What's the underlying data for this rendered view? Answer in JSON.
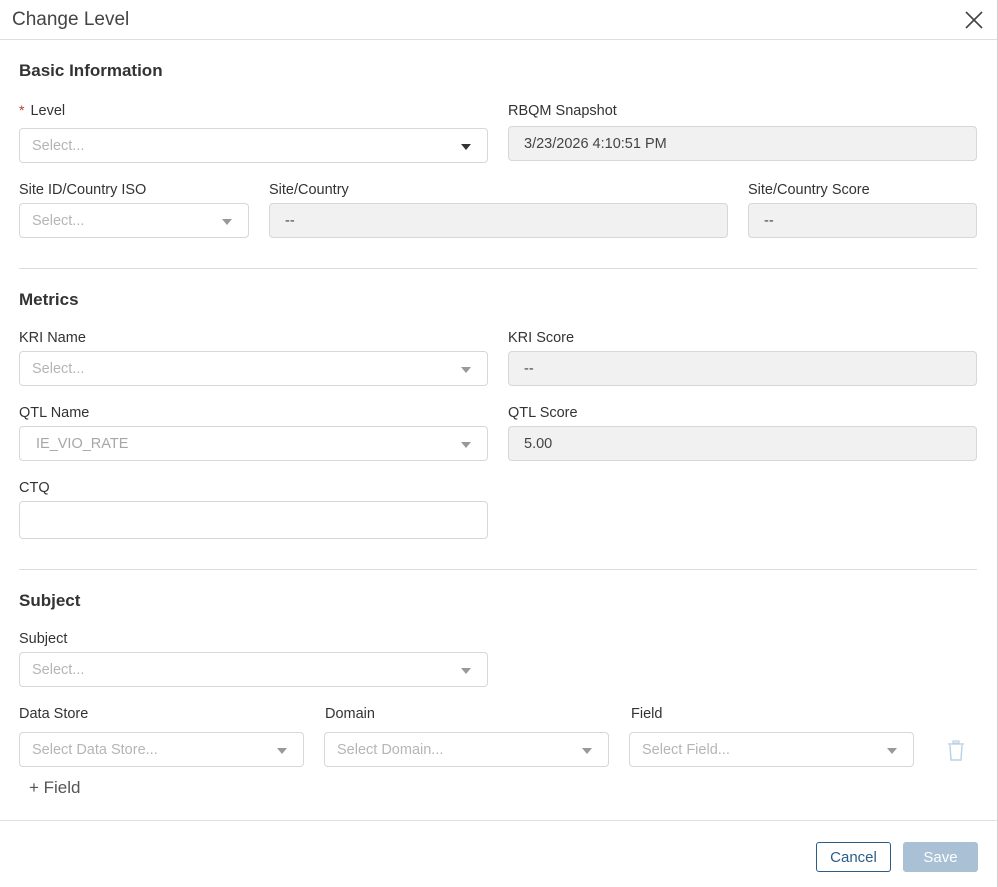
{
  "dialog": {
    "title": "Change Level",
    "close_icon": "close-icon"
  },
  "basic": {
    "section_title": "Basic Information",
    "level_label": "Level",
    "level_required_mark": "*",
    "level_placeholder": "Select...",
    "snapshot_label": "RBQM Snapshot",
    "snapshot_value": "3/23/2026 4:10:51 PM",
    "site_id_label": "Site ID/Country ISO",
    "site_id_placeholder": "Select...",
    "site_country_label": "Site/Country",
    "site_country_value": "--",
    "site_score_label": "Site/Country Score",
    "site_score_value": "--"
  },
  "metrics": {
    "section_title": "Metrics",
    "kri_name_label": "KRI Name",
    "kri_name_placeholder": "Select...",
    "kri_score_label": "KRI Score",
    "kri_score_value": "--",
    "qtl_name_label": "QTL Name",
    "qtl_name_value": "IE_VIO_RATE",
    "qtl_score_label": "QTL Score",
    "qtl_score_value": "5.00",
    "ctq_label": "CTQ",
    "ctq_value": ""
  },
  "subject": {
    "section_title": "Subject",
    "subject_label": "Subject",
    "subject_placeholder": "Select...",
    "data_store_label": "Data Store",
    "data_store_placeholder": "Select Data Store...",
    "domain_label": "Domain",
    "domain_placeholder": "Select Domain...",
    "field_label": "Field",
    "field_placeholder": "Select Field...",
    "add_field_label": "+ Field",
    "delete_icon": "trash-icon"
  },
  "footer": {
    "cancel_label": "Cancel",
    "save_label": "Save"
  }
}
